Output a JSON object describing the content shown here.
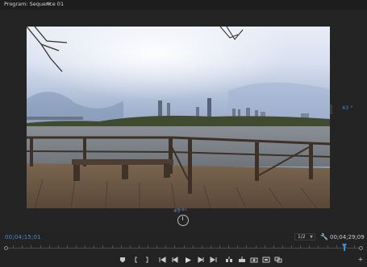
{
  "panel": {
    "title": "Program: Sequence 01",
    "menu_icon": "hamburger-icon"
  },
  "vr": {
    "right_angle": "43 °",
    "bottom_angle": "43 °",
    "dial_icon": "vr-rotation-dial-icon"
  },
  "timecode": {
    "current": "00;04;15;01",
    "duration": "00;04;29;09"
  },
  "resolution": {
    "selected": "1/2"
  },
  "playhead_position": 0.948,
  "controls": [
    "add-marker-icon",
    "mark-in-icon",
    "mark-out-icon",
    "go-to-in-icon",
    "step-back-icon",
    "play-icon",
    "step-forward-icon",
    "go-to-out-icon",
    "insert-icon",
    "overwrite-icon",
    "export-frame-icon",
    "toggle-vr-icon",
    "compare-view-icon",
    "button-editor-plus-icon"
  ],
  "colors": {
    "accent": "#3b8fd6",
    "panel_bg": "#232323"
  }
}
